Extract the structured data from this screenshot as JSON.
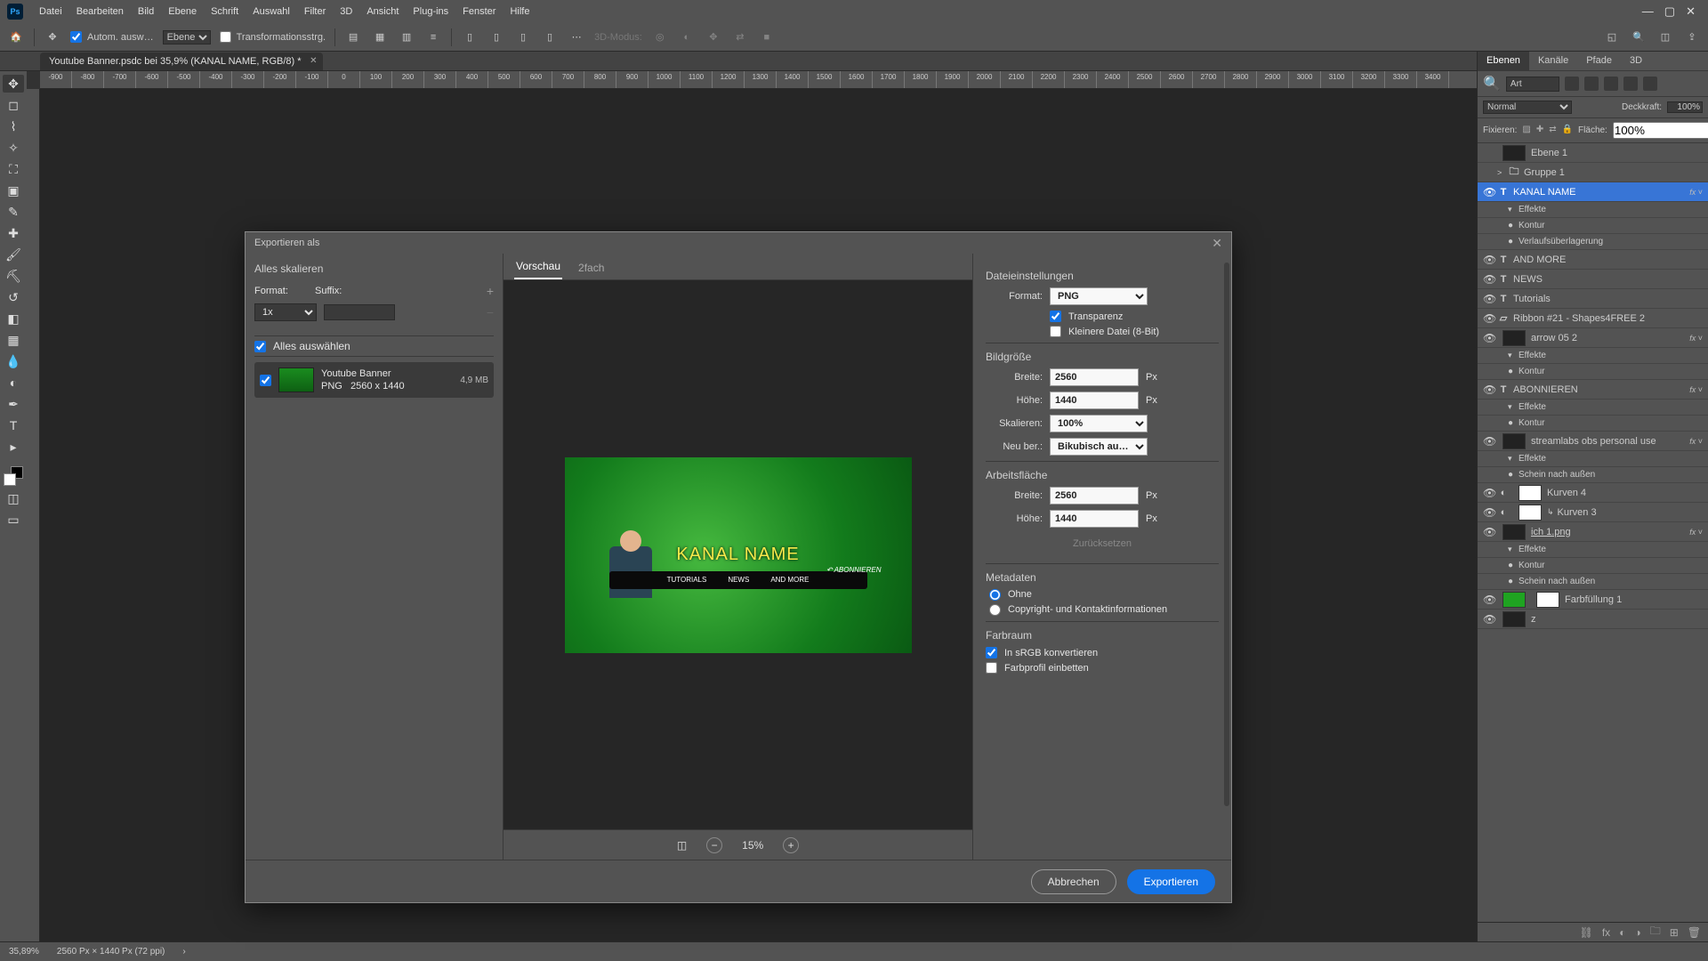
{
  "menubar": {
    "items": [
      "Datei",
      "Bearbeiten",
      "Bild",
      "Ebene",
      "Schrift",
      "Auswahl",
      "Filter",
      "3D",
      "Ansicht",
      "Plug-ins",
      "Fenster",
      "Hilfe"
    ],
    "ps": "Ps"
  },
  "options": {
    "auto": "Autom. ausw…",
    "layer": "Ebene",
    "transform": "Transformationsstrg.",
    "mode3d": "3D-Modus:"
  },
  "doc_tab": {
    "title": "Youtube Banner.psdc bei 35,9% (KANAL NAME, RGB/8) *"
  },
  "ruler_ticks": [
    "-900",
    "-800",
    "-700",
    "-600",
    "-500",
    "-400",
    "-300",
    "-200",
    "-100",
    "0",
    "100",
    "200",
    "300",
    "400",
    "500",
    "600",
    "700",
    "800",
    "900",
    "1000",
    "1100",
    "1200",
    "1300",
    "1400",
    "1500",
    "1600",
    "1700",
    "1800",
    "1900",
    "2000",
    "2100",
    "2200",
    "2300",
    "2400",
    "2500",
    "2600",
    "2700",
    "2800",
    "2900",
    "3000",
    "3100",
    "3200",
    "3300",
    "3400"
  ],
  "status": {
    "zoom": "35,89%",
    "info": "2560 Px × 1440 Px (72 ppi)"
  },
  "panels": {
    "tabs": [
      "Ebenen",
      "Kanäle",
      "Pfade",
      "3D"
    ],
    "search": "Art",
    "blend": "Normal",
    "opacity_label": "Deckkraft:",
    "opacity": "100%",
    "lock_label": "Fixieren:",
    "fill_label": "Fläche:",
    "fill": "100%",
    "layers": [
      {
        "eye": false,
        "name": "Ebene 1",
        "thumb": "black"
      },
      {
        "eye": false,
        "arrow": ">",
        "folder": true,
        "name": "Gruppe 1"
      },
      {
        "eye": true,
        "type": "T",
        "name": "KANAL NAME",
        "selected": true,
        "fx": true
      },
      {
        "sub": true,
        "name": "Effekte",
        "open": true
      },
      {
        "sub": true,
        "bullet": true,
        "name": "Kontur"
      },
      {
        "sub": true,
        "bullet": true,
        "name": "Verlaufsüberlagerung"
      },
      {
        "eye": true,
        "type": "T",
        "name": "AND MORE"
      },
      {
        "eye": true,
        "type": "T",
        "name": "NEWS"
      },
      {
        "eye": true,
        "type": "T",
        "name": "Tutorials"
      },
      {
        "eye": true,
        "shape": true,
        "name": "Ribbon #21 - Shapes4FREE 2"
      },
      {
        "eye": true,
        "thumb": "black",
        "name": "arrow 05 2",
        "fx": true
      },
      {
        "sub": true,
        "name": "Effekte",
        "open": true
      },
      {
        "sub": true,
        "bullet": true,
        "name": "Kontur"
      },
      {
        "eye": true,
        "type": "T",
        "name": "ABONNIEREN",
        "fx": true
      },
      {
        "sub": true,
        "name": "Effekte",
        "open": true
      },
      {
        "sub": true,
        "bullet": true,
        "name": "Kontur"
      },
      {
        "eye": true,
        "thumb": "black",
        "name": "streamlabs obs personal use",
        "fx": true
      },
      {
        "sub": true,
        "name": "Effekte",
        "open": true
      },
      {
        "sub": true,
        "bullet": true,
        "name": "Schein nach außen"
      },
      {
        "eye": true,
        "adj": true,
        "thumb": "white",
        "name": "Kurven 4"
      },
      {
        "eye": true,
        "adj": true,
        "thumb": "white",
        "name": "Kurven 3",
        "clipped": true
      },
      {
        "eye": true,
        "thumb": "black",
        "name": "ich 1.png",
        "fx": true,
        "strike": true
      },
      {
        "sub": true,
        "name": "Effekte",
        "open": true
      },
      {
        "sub": true,
        "bullet": true,
        "name": "Kontur"
      },
      {
        "sub": true,
        "bullet": true,
        "name": "Schein nach außen"
      },
      {
        "eye": true,
        "thumb": "green",
        "mask": "white",
        "name": "Farbfüllung 1"
      },
      {
        "eye": true,
        "thumb": "black",
        "name": "z"
      }
    ]
  },
  "dialog": {
    "title": "Exportieren als",
    "left": {
      "scale_all": "Alles skalieren",
      "format_lbl": "Format:",
      "suffix_lbl": "Suffix:",
      "scale_value": "1x",
      "select_all": "Alles auswählen",
      "asset": {
        "name": "Youtube Banner",
        "fmt": "PNG",
        "dim": "2560 x 1440",
        "size": "4,9 MB"
      }
    },
    "center": {
      "tabs": [
        "Vorschau",
        "2fach"
      ],
      "banner_title": "KANAL NAME",
      "sub1": "TUTORIALS",
      "sub2": "NEWS",
      "sub3": "AND MORE",
      "abo": "ABONNIEREN",
      "zoom": "15%"
    },
    "right": {
      "file_settings": "Dateieinstellungen",
      "format_lbl": "Format:",
      "format_val": "PNG",
      "transparency": "Transparenz",
      "small_file": "Kleinere Datei (8-Bit)",
      "image_size": "Bildgröße",
      "width_lbl": "Breite:",
      "width_val": "2560",
      "height_lbl": "Höhe:",
      "height_val": "1440",
      "scale_lbl": "Skalieren:",
      "scale_val": "100%",
      "resample_lbl": "Neu ber.:",
      "resample_val": "Bikubisch au…",
      "canvas": "Arbeitsfläche",
      "c_width_lbl": "Breite:",
      "c_width_val": "2560",
      "c_height_lbl": "Höhe:",
      "c_height_val": "1440",
      "reset": "Zurücksetzen",
      "metadata": "Metadaten",
      "meta_none": "Ohne",
      "meta_copy": "Copyright- und Kontaktinformationen",
      "colorspace": "Farbraum",
      "srgb": "In sRGB konvertieren",
      "embed": "Farbprofil einbetten",
      "px": "Px"
    },
    "footer": {
      "cancel": "Abbrechen",
      "export": "Exportieren"
    }
  }
}
